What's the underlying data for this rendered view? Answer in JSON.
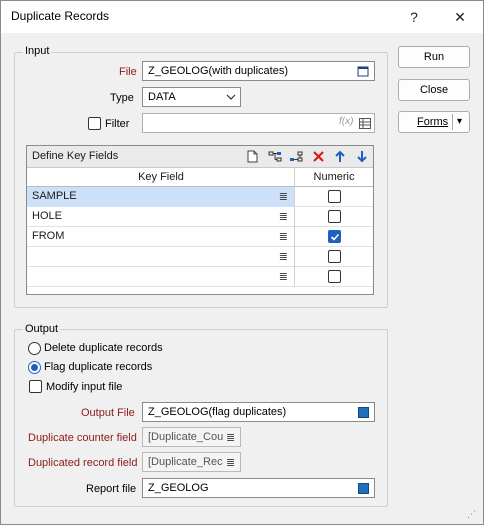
{
  "window": {
    "title": "Duplicate Records",
    "help": "?",
    "close": "✕"
  },
  "buttons": {
    "run": "Run",
    "close": "Close",
    "forms": "Forms",
    "forms_arrow": "▾"
  },
  "input": {
    "group_label": "Input",
    "file_label": "File",
    "file_value": "Z_GEOLOG(with duplicates)",
    "type_label": "Type",
    "type_value": "DATA",
    "filter_label": "Filter",
    "filter_checked": false,
    "filter_value": ""
  },
  "key_fields": {
    "title": "Define Key Fields",
    "col_key": "Key Field",
    "col_numeric": "Numeric",
    "rows": [
      {
        "key": "SAMPLE",
        "numeric": false,
        "selected": true
      },
      {
        "key": "HOLE",
        "numeric": false,
        "selected": false
      },
      {
        "key": "FROM",
        "numeric": true,
        "selected": false
      },
      {
        "key": "",
        "numeric": false,
        "selected": false
      },
      {
        "key": "",
        "numeric": false,
        "selected": false
      }
    ]
  },
  "output": {
    "group_label": "Output",
    "opt_delete": "Delete duplicate records",
    "opt_flag": "Flag duplicate records",
    "selected": "flag",
    "modify_label": "Modify input file",
    "modify_checked": false,
    "output_file_label": "Output File",
    "output_file_value": "Z_GEOLOG(flag duplicates)",
    "counter_label": "Duplicate counter field",
    "counter_value": "[Duplicate_Cou",
    "dup_field_label": "Duplicated record field",
    "dup_field_value": "[Duplicate_Rec",
    "report_label": "Report file",
    "report_value": "Z_GEOLOG"
  },
  "colors": {
    "accent": "#1f5fbf",
    "required_label": "#8b1a1a",
    "selection": "#cce0f7"
  }
}
